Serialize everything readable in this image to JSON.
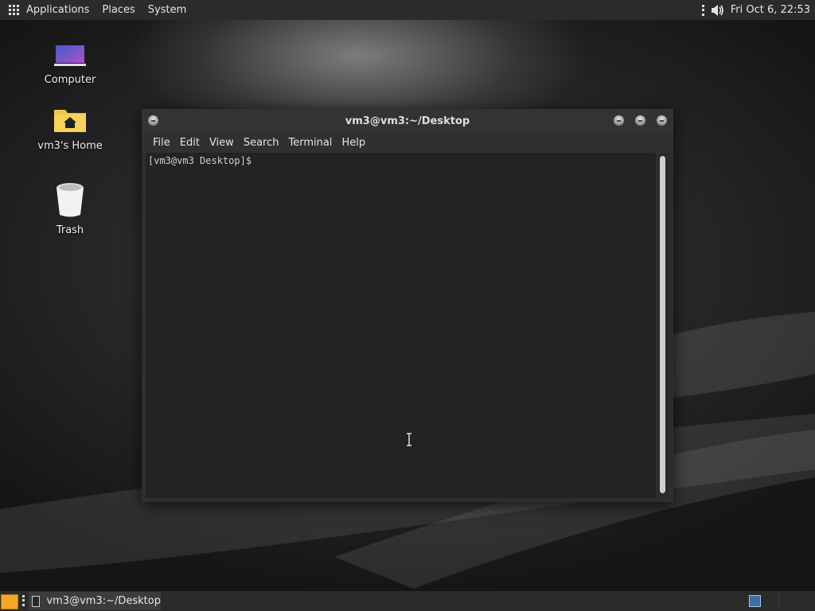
{
  "top_panel": {
    "menus": [
      "Applications",
      "Places",
      "System"
    ],
    "clock": "Fri Oct  6, 22:53",
    "icons": {
      "apps": "apps-grid-icon",
      "volume": "volume-icon"
    }
  },
  "desktop": {
    "icons": [
      {
        "label": "Computer",
        "icon": "computer-icon"
      },
      {
        "label": "vm3's Home",
        "icon": "home-folder-icon"
      },
      {
        "label": "Trash",
        "icon": "trash-icon"
      }
    ]
  },
  "terminal": {
    "title": "vm3@vm3:~/Desktop",
    "menu": [
      "File",
      "Edit",
      "View",
      "Search",
      "Terminal",
      "Help"
    ],
    "prompt": "[vm3@vm3 Desktop]$ "
  },
  "bottom_panel": {
    "task_label": "vm3@vm3:~/Desktop"
  },
  "colors": {
    "accent": "#f5a623",
    "workspace": "#3a6ea5"
  }
}
